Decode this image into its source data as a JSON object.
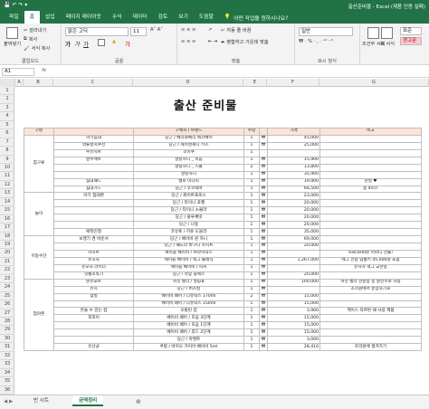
{
  "window": {
    "doc_title": "출산준비물 - Excel (제품 인증 실패)"
  },
  "menu": {
    "tabs": [
      "파일",
      "홈",
      "삽입",
      "페이지 레이아웃",
      "수식",
      "데이터",
      "검토",
      "보기",
      "도움말"
    ],
    "tell_me": "어떤 작업을 원하시나요?"
  },
  "ribbon": {
    "clipboard": {
      "paste": "붙여넣기",
      "cut": "잘라내기",
      "copy": "복사",
      "format_painter": "서식 복사",
      "label": "클립보드"
    },
    "font": {
      "name": "맑은 고딕",
      "size": "11",
      "label": "글꼴"
    },
    "align": {
      "wrap": "자동 줄 바꿈",
      "merge": "병합하고 가운데 맞춤",
      "label": "맞춤"
    },
    "number": {
      "format": "일반",
      "label": "표시 형식"
    },
    "styles": {
      "cond": "조건부 서식",
      "table": "표 서식",
      "normal": "표준",
      "bad": "경고문"
    }
  },
  "formula_bar": {
    "name_box": "A1",
    "fx": "fx"
  },
  "columns": [
    "A",
    "B",
    "C",
    "D",
    "E",
    "F",
    "G"
  ],
  "sheet": {
    "title": "출산 준비물",
    "headers": [
      "구분",
      "",
      "구매처 / 브랜드",
      "수량",
      "",
      "가격",
      "비고"
    ],
    "rows": [
      [
        "",
        "아기침대",
        "당근 / 베리와베리 에코베어",
        "1",
        "₩",
        "45,000",
        ""
      ],
      [
        "",
        "역류방지쿠션",
        "당근 / 제이엔제니 키즈",
        "1",
        "₩",
        "25,000",
        ""
      ],
      [
        "",
        "수유시트",
        "조이쿠",
        "1",
        "",
        "",
        " "
      ],
      [
        "",
        "방수매트",
        "말랑하니 _ 미듐",
        "1",
        "₩",
        "15,900",
        ""
      ],
      [
        "",
        "",
        "말랑하니 _ 스몰",
        "2",
        "₩",
        "13,800",
        ""
      ],
      [
        "",
        "",
        "말랑하니",
        "1",
        "₩",
        "35,900",
        ""
      ],
      [
        "",
        "침대패드",
        "헬로 미니미",
        "1",
        "₩",
        "19,900",
        "찬킬 ♥"
      ],
      [
        "",
        "침대가드",
        "당근 / 코코테바",
        "1",
        "₩",
        "66,500",
        "총 4피스"
      ],
      [
        "",
        "아기 침대편",
        "당근 / 화이트프로스",
        "1",
        "₩",
        "23,000",
        ""
      ],
      [
        "",
        "",
        "당근 / 타이니 포헬",
        "1",
        "₩",
        "20,000",
        ""
      ],
      [
        "",
        "",
        "당근 / 타이니 소클라",
        "1",
        "₩",
        "20,000",
        ""
      ],
      [
        "",
        "",
        "당근 / 블루체빗",
        "1",
        "₩",
        "20,000",
        ""
      ],
      [
        "",
        "",
        "당근 / 나동",
        "1",
        "₩",
        "20,000",
        ""
      ],
      [
        "",
        "애착인형",
        "코유토 / 히쥬 도블라",
        "1",
        "₩",
        "35,000",
        ""
      ],
      [
        "",
        "",
        "당근 / 베이비 윈 하니",
        "1",
        "₩",
        "69,000",
        ""
      ],
      [
        "",
        "",
        "당근 / 패도라 바구니 카시트",
        "1",
        "₩",
        "20,000",
        ""
      ],
      [
        "",
        "",
        "에이블 베이비 / 브라이덕스",
        "1",
        "₩",
        "",
        "930,600원 이마니 선물!"
      ],
      [
        "",
        "",
        "에이블 베이비 / 엑그 클래식",
        "1",
        "₩",
        "1,267,000",
        "에그 전용 업통키 45,000원 포함"
      ],
      [
        "",
        "",
        "에이블 베이비 / 피커",
        "1",
        "₩",
        "",
        "유사카 엑그 교한용"
      ],
      [
        "",
        "",
        "당근 / 유망 블랙스",
        "1",
        "₩",
        "20,000",
        ""
      ],
      [
        "",
        "",
        "까칫 헬리 / 필링표",
        "1",
        "₩",
        "100,000",
        "까칫 헬리 한동용 등 할인주로 사용"
      ],
      [
        "",
        "",
        "당근 / 버즈칼",
        "1",
        "₩",
        "",
        "조리원에서 끝장하기로"
      ],
      [
        "",
        "",
        "베이비 페어 / 디퓨락스 170ml",
        "2",
        "₩",
        "15,000",
        ""
      ],
      [
        "",
        "",
        "베이비 페어 / 디퓨락스 150ml",
        "1",
        "₩",
        "15,000",
        ""
      ],
      [
        "",
        "",
        "오빌린 컵",
        "1",
        "₩",
        "3,900",
        "케이스 자르된 때 사용 제품"
      ],
      [
        "",
        "",
        "베이비 페어 / 모음 3단계",
        "1",
        "₩",
        "15,000",
        ""
      ],
      [
        "",
        "",
        "베이비 페어 / 모음 1단계",
        "1",
        "₩",
        "15,000",
        ""
      ],
      [
        "",
        "",
        "베이비 페어 / 후드 2단계",
        "1",
        "₩",
        "15,000",
        ""
      ],
      [
        "",
        "",
        "당근 / 아벤트",
        "1",
        "₩",
        "3,000",
        ""
      ],
      [
        "",
        "유산균",
        "쿠팡 / 바이오 가이아 베이비 5ml",
        "1",
        "₩",
        "28,410",
        "조리원에 챙겨가기"
      ]
    ],
    "groups": [
      {
        "label": "침구류",
        "start": 0,
        "span": 8
      },
      {
        "label": "놀이",
        "start": 8,
        "span": 6
      },
      {
        "label": "이동수단",
        "start": 14,
        "span": 6
      },
      {
        "label": "엄마존",
        "start": 20,
        "span": 10
      }
    ],
    "subgroups": [
      {
        "label": "보행기 겸 바운서",
        "row": 14
      },
      {
        "label": "카시트",
        "row": 16
      },
      {
        "label": "유모차",
        "row": 17
      },
      {
        "label": "유모차 라이너",
        "row": 18
      },
      {
        "label": "힛펠소독기",
        "row": 19
      },
      {
        "label": "분유포트",
        "row": 20
      },
      {
        "label": "유시",
        "row": 21
      },
      {
        "label": "젖병",
        "row": 22
      },
      {
        "label": "흔들 수 있는 컵",
        "row": 24
      },
      {
        "label": "쪽쪽이",
        "row": 25
      }
    ]
  },
  "sheet_tabs": [
    "빈 시트",
    "금액정리"
  ],
  "active_tab": 1
}
